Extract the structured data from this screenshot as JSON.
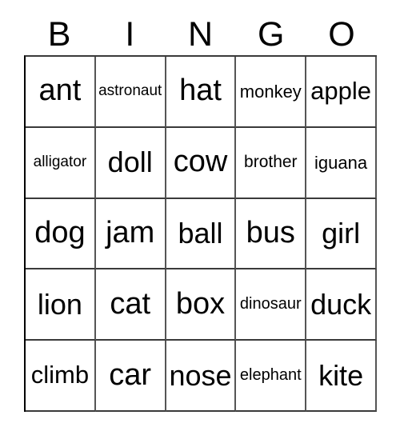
{
  "card": {
    "title": "BINGO",
    "header_letters": [
      "B",
      "I",
      "N",
      "G",
      "O"
    ],
    "grid_size": "5x5",
    "colors": {
      "background": "#ffffff",
      "text": "#000000",
      "border": "#3a3a3a"
    },
    "rows": [
      {
        "cells": [
          {
            "word": "ant"
          },
          {
            "word": "astronaut"
          },
          {
            "word": "hat"
          },
          {
            "word": "monkey"
          },
          {
            "word": "apple"
          }
        ]
      },
      {
        "cells": [
          {
            "word": "alligator"
          },
          {
            "word": "doll"
          },
          {
            "word": "cow"
          },
          {
            "word": "brother"
          },
          {
            "word": "iguana"
          }
        ]
      },
      {
        "cells": [
          {
            "word": "dog"
          },
          {
            "word": "jam"
          },
          {
            "word": "ball"
          },
          {
            "word": "bus"
          },
          {
            "word": "girl"
          }
        ]
      },
      {
        "cells": [
          {
            "word": "lion"
          },
          {
            "word": "cat"
          },
          {
            "word": "box"
          },
          {
            "word": "dinosaur"
          },
          {
            "word": "duck"
          }
        ]
      },
      {
        "cells": [
          {
            "word": "climb"
          },
          {
            "word": "car"
          },
          {
            "word": "nose"
          },
          {
            "word": "elephant"
          },
          {
            "word": "kite"
          }
        ]
      }
    ]
  }
}
